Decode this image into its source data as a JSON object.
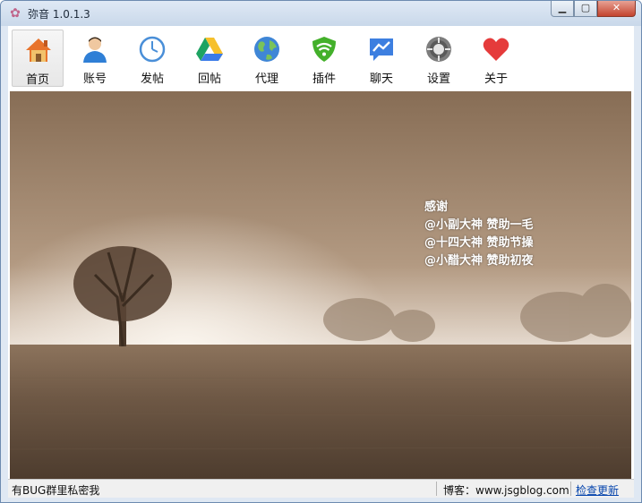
{
  "window": {
    "title": "弥音 1.0.1.3",
    "app_icon": "flower-icon"
  },
  "toolbar": {
    "items": [
      {
        "label": "首页",
        "icon": "home-icon",
        "active": true
      },
      {
        "label": "账号",
        "icon": "user-icon"
      },
      {
        "label": "发帖",
        "icon": "clock-icon"
      },
      {
        "label": "回帖",
        "icon": "drive-triangle-icon"
      },
      {
        "label": "代理",
        "icon": "globe-icon"
      },
      {
        "label": "插件",
        "icon": "shield-wifi-icon"
      },
      {
        "label": "聊天",
        "icon": "chat-bubble-icon"
      },
      {
        "label": "设置",
        "icon": "gear-icon"
      },
      {
        "label": "关于",
        "icon": "heart-icon"
      }
    ]
  },
  "content": {
    "thanks": [
      "感谢",
      "@小副大神 赞助一毛",
      "@十四大神 赞助节操",
      "@小醋大神 赞助初夜"
    ]
  },
  "statusbar": {
    "left_text": "有BUG群里私密我",
    "blog_text": "博客：www.jsgblog.com",
    "update_link": "检查更新"
  },
  "colors": {
    "accent_blue": "#0645ad",
    "title_bar": "#c9d8ea",
    "sepia_sky": "#a48a6e"
  }
}
